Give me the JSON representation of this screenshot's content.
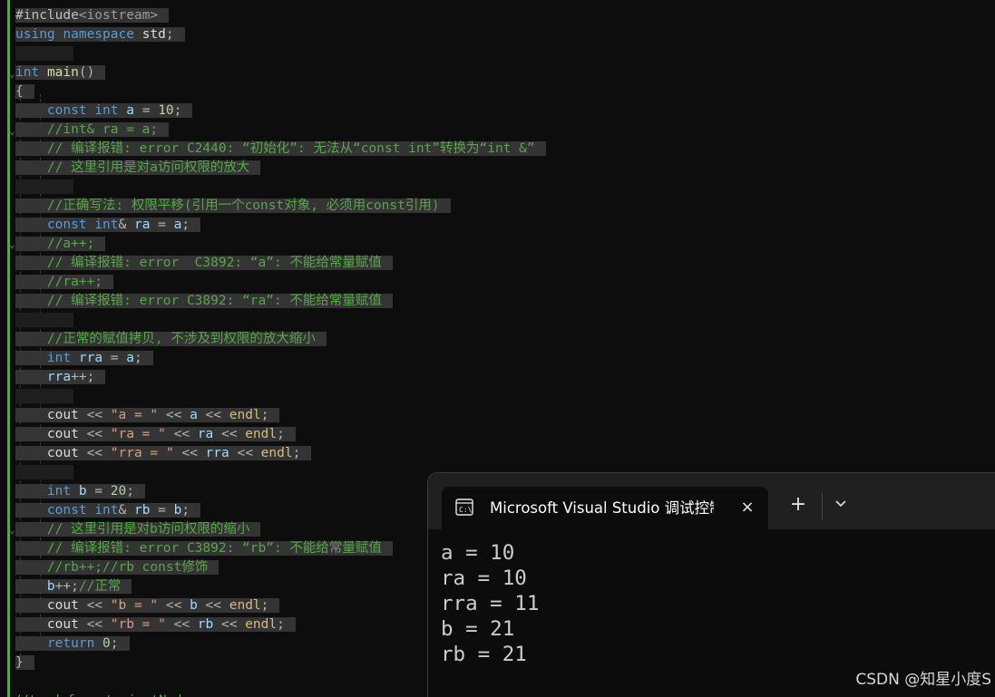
{
  "editor": {
    "lines": [
      {
        "text": "#include<iostream>"
      },
      {
        "text": "using namespace std;"
      },
      {
        "text": ""
      },
      {
        "text": "int main()"
      },
      {
        "text": "{"
      },
      {
        "text": "    const int a = 10;"
      },
      {
        "text": "    //int& ra = a;"
      },
      {
        "text": "    // 编译报错: error C2440: “初始化”: 无法从“const int”转换为“int &”"
      },
      {
        "text": "    // 这里引用是对a访问权限的放大"
      },
      {
        "text": ""
      },
      {
        "text": "    //正确写法: 权限平移(引用一个const对象, 必须用const引用)"
      },
      {
        "text": "    const int& ra = a;"
      },
      {
        "text": "    //a++;"
      },
      {
        "text": "    // 编译报错: error  C3892: “a”: 不能给常量赋值"
      },
      {
        "text": "    //ra++;"
      },
      {
        "text": "    // 编译报错: error C3892: “ra”: 不能给常量赋值"
      },
      {
        "text": ""
      },
      {
        "text": "    //正常的赋值拷贝, 不涉及到权限的放大缩小"
      },
      {
        "text": "    int rra = a;"
      },
      {
        "text": "    rra++;"
      },
      {
        "text": ""
      },
      {
        "text": "    cout << \"a = \" << a << endl;"
      },
      {
        "text": "    cout << \"ra = \" << ra << endl;"
      },
      {
        "text": "    cout << \"rra = \" << rra << endl;"
      },
      {
        "text": ""
      },
      {
        "text": "    int b = 20;"
      },
      {
        "text": "    const int& rb = b;"
      },
      {
        "text": "    // 这里引用是对b访问权限的缩小"
      },
      {
        "text": "    // 编译报错: error C3892: “rb”: 不能给常量赋值"
      },
      {
        "text": "    //rb++;//rb const修饰"
      },
      {
        "text": "    b++;//正常"
      },
      {
        "text": "    cout << \"b = \" << b << endl;"
      },
      {
        "text": "    cout << \"rb = \" << rb << endl;"
      },
      {
        "text": "    return 0;"
      },
      {
        "text": "}"
      }
    ]
  },
  "console": {
    "tab_title": "Microsoft Visual Studio 调试控制台",
    "icon": "terminal-icon",
    "close_icon": "×",
    "new_tab_icon": "+",
    "dropdown_icon": "chevron-down-icon",
    "output": [
      "a = 10",
      "ra = 10",
      "rra = 11",
      "b = 21",
      "rb = 21"
    ]
  },
  "watermark": "CSDN @知星小度S",
  "colors": {
    "background": "#0d0d0d",
    "keyword": "#569cd6",
    "comment": "#57a64a",
    "string": "#d69d85",
    "number": "#b5cea8",
    "selection": "#343434",
    "console_tabbar": "#202020"
  }
}
